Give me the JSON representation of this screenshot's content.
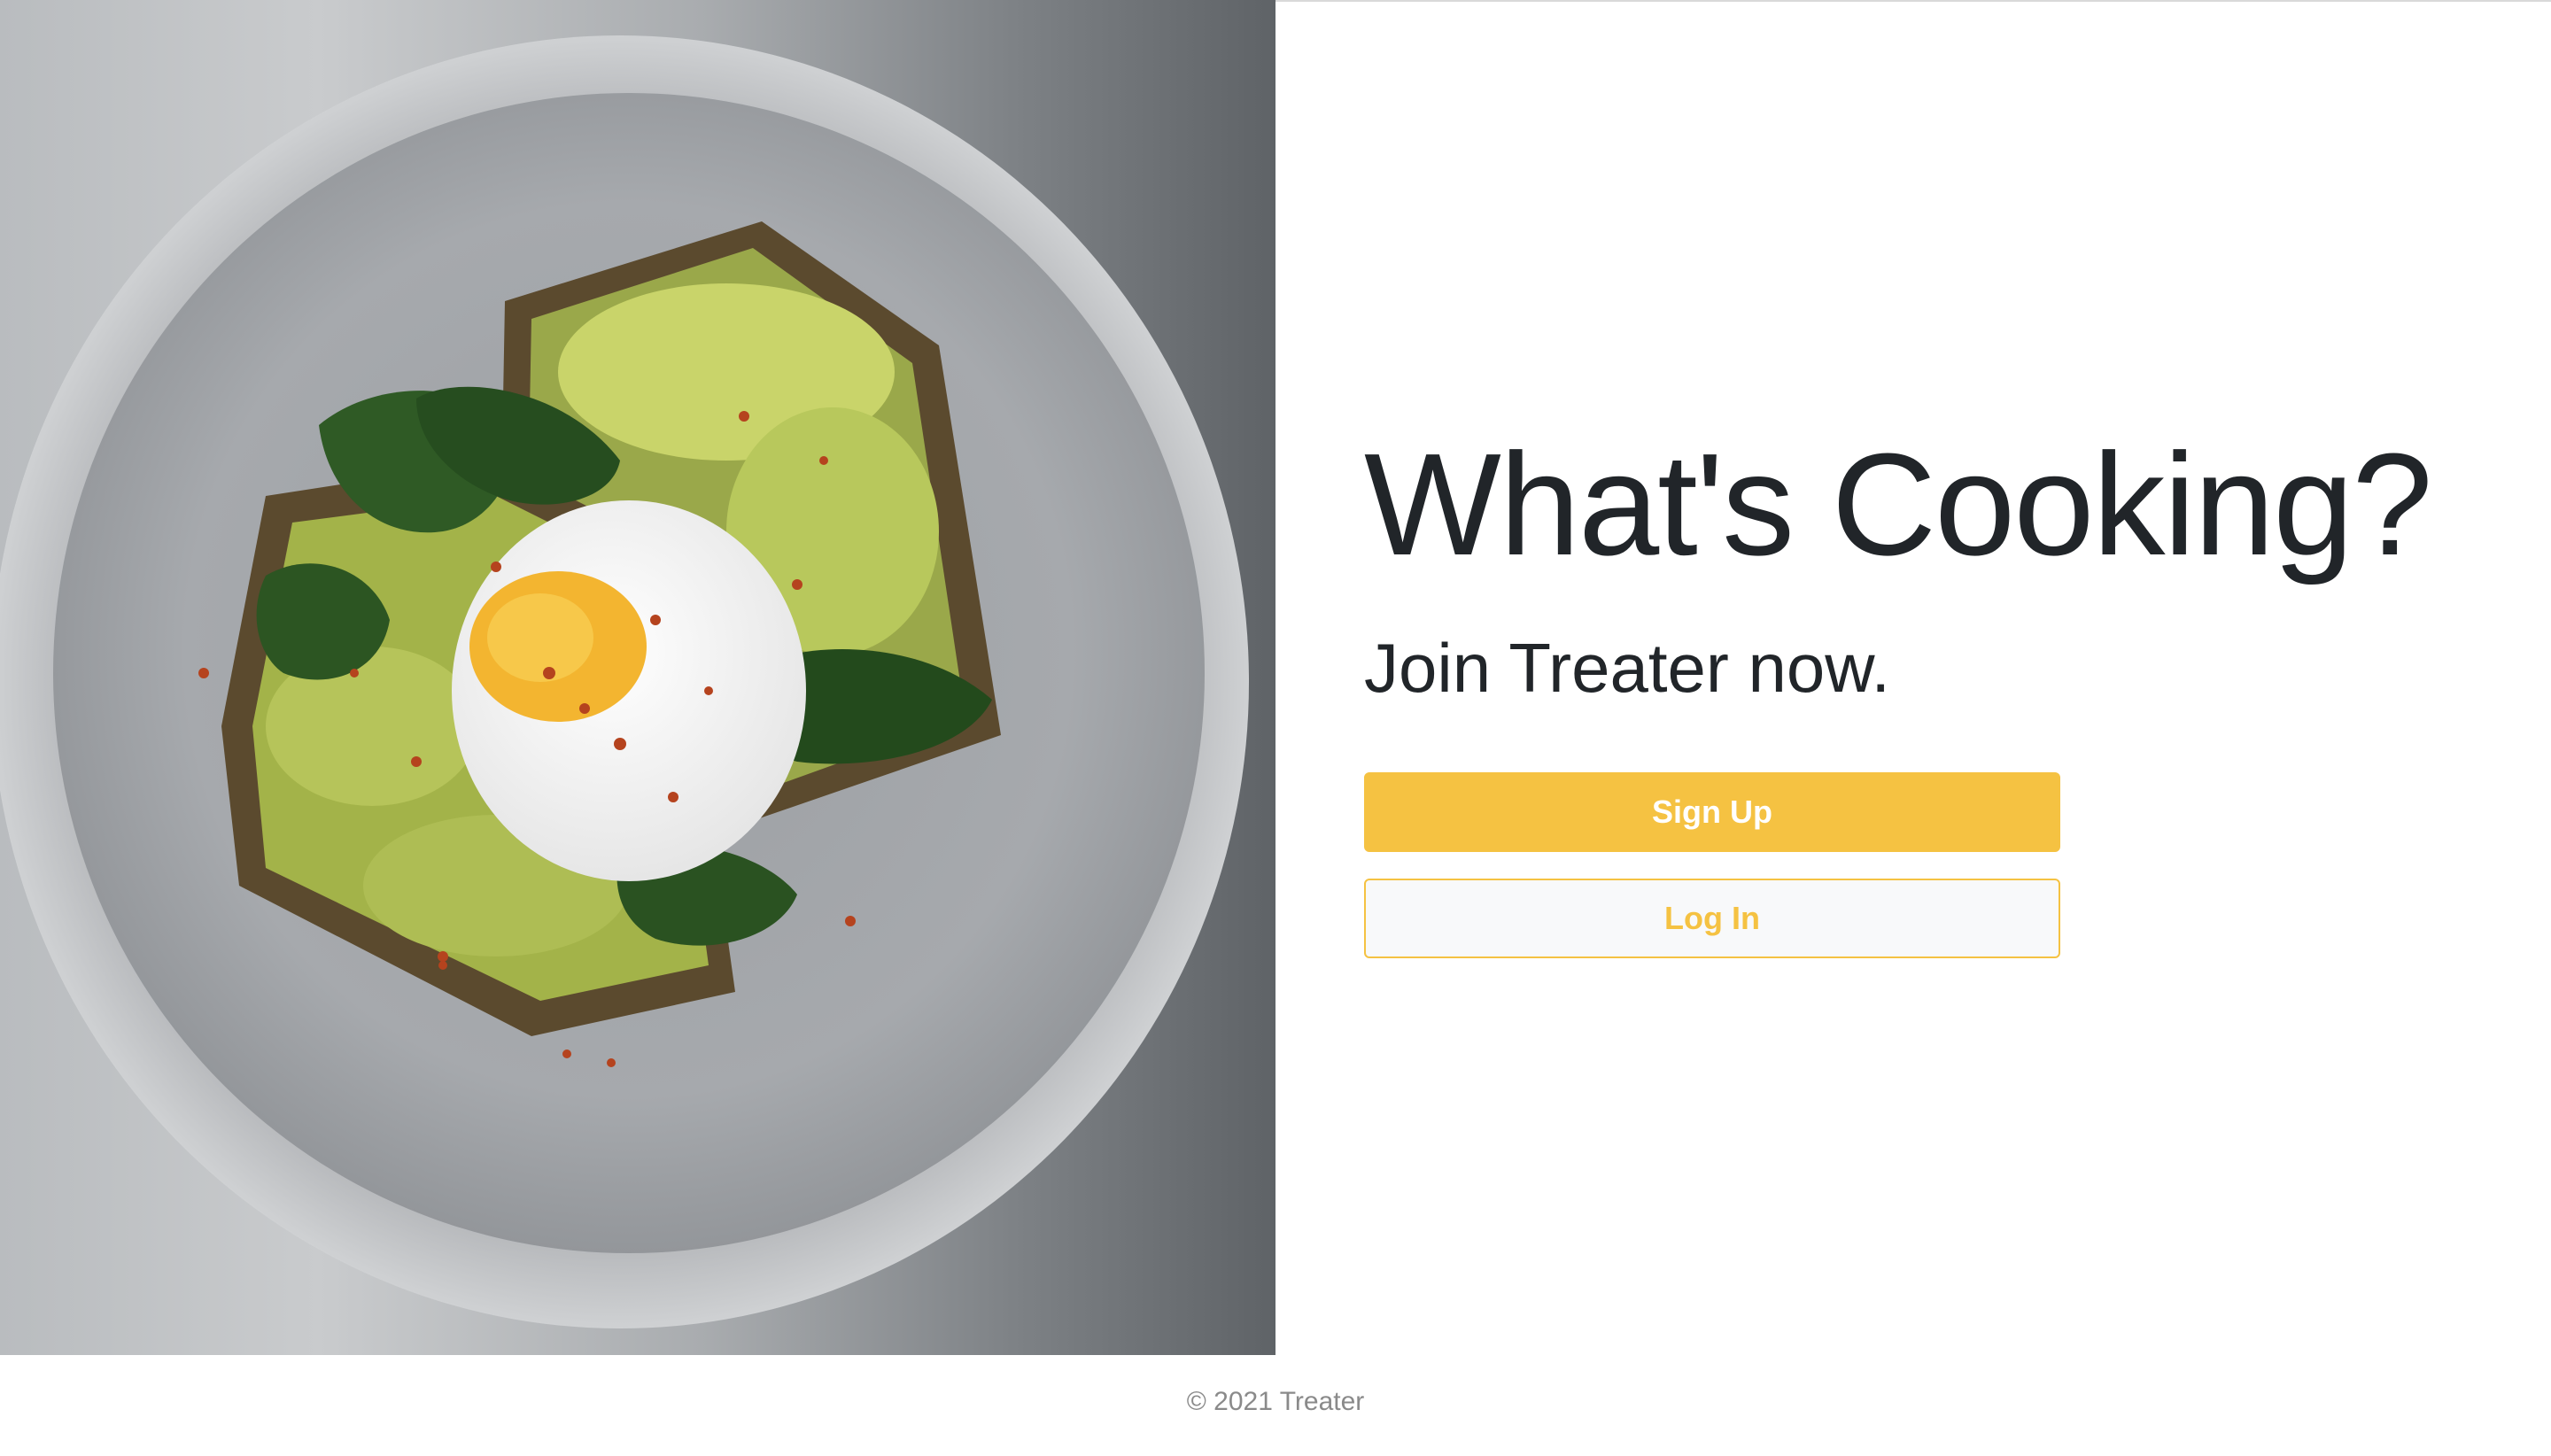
{
  "hero": {
    "headline": "What's Cooking?",
    "subline": "Join Treater now."
  },
  "actions": {
    "signup_label": "Sign Up",
    "login_label": "Log In"
  },
  "footer": {
    "text": "© 2021 Treater"
  },
  "colors": {
    "accent": "#f5c242",
    "text_dark": "#212529",
    "footer_text": "#8a8a8a"
  }
}
